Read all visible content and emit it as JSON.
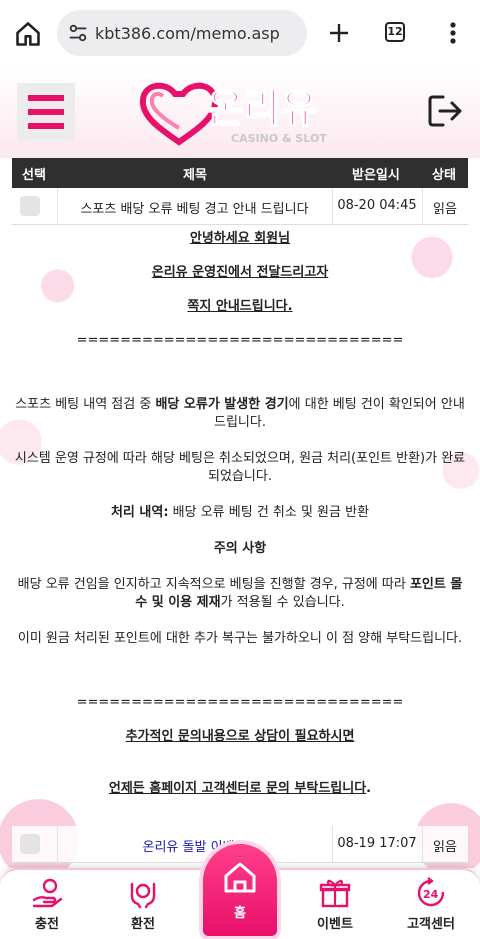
{
  "browser": {
    "url": "kbt386.com/memo.asp",
    "tab_count": "12",
    "icons": [
      "home-icon",
      "tune-icon",
      "plus-icon",
      "tabs-icon",
      "more-vert-icon"
    ]
  },
  "header": {
    "logo_text": "온리유",
    "logo_sub": "CASINO & SLOT",
    "icons": [
      "menu-icon",
      "logout-icon"
    ]
  },
  "table": {
    "columns": [
      "선택",
      "제목",
      "받은일시",
      "상태"
    ],
    "rows": [
      {
        "subject": "스포츠 배당 오류 베팅 경고 안내 드립니다",
        "date": "08-20 04:45",
        "status": "읽음"
      },
      {
        "subject": "온리유 돌발 이벤트",
        "date": "08-19 17:07",
        "status": "읽음"
      }
    ]
  },
  "message": {
    "greeting": "안녕하세요 회원님",
    "line2": "온리유 운영진에서 전달드리고자",
    "line3": "쪽지 안내드립니다.",
    "divider": "==============================",
    "p1_a": "스포츠 베팅 내역 점검 중 ",
    "p1_b": "배당 오류가 발생한 경기",
    "p1_c": "에 대한 베팅 건이 확인되어 안내드립니다.",
    "p2": "시스템 운영 규정에 따라 해당 베팅은 취소되었으며, 원금 처리(포인트 반환)가 완료되었습니다.",
    "p3_label": "처리 내역:",
    "p3_text": " 배당 오류 베팅 건 취소 및 원금 반환",
    "caution_title": "주의 사항",
    "p4_a": "배당 오류 건임을 인지하고 지속적으로 베팅을 진행할 경우, 규정에 따라 ",
    "p4_b": "포인트 몰수 및 이용 제재",
    "p4_c": "가 적용될 수 있습니다.",
    "p5": "이미 원금 처리된 포인트에 대한 추가 복구는 불가하오니 이 점 양해 부탁드립니다.",
    "contact1": "추가적인 문의내용으로 상담이 필요하시면",
    "contact2": "언제든 홈페이지 고객센터로 문의 부탁드립니다",
    "contact2_end": "."
  },
  "nav": {
    "items": [
      "충전",
      "환전",
      "홈",
      "이벤트",
      "고객센터"
    ]
  },
  "colors": {
    "brand": "#e8106b",
    "table_header": "#2f2f2f",
    "link_blue": "#1a1aa8"
  }
}
